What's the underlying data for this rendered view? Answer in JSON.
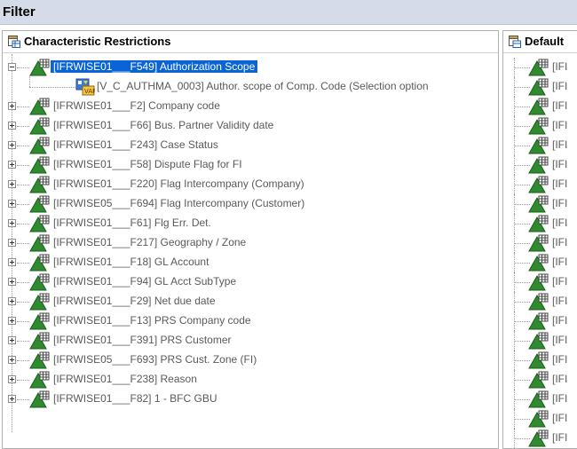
{
  "window": {
    "title": "Filter"
  },
  "left_panel": {
    "header": "Characteristic Restrictions",
    "selected_item": "[IFRWISE01___F549] Authorization Scope",
    "sub_item": "[V_C_AUTHMA_0003] Author. scope of Comp. Code (Selection option",
    "items": [
      "[IFRWISE01___F2] Company code",
      "[IFRWISE01___F66] Bus. Partner Validity date",
      "[IFRWISE01___F243] Case Status",
      "[IFRWISE01___F58] Dispute Flag for FI",
      "[IFRWISE01___F220] Flag Intercompany (Company)",
      "[IFRWISE05___F694] Flag Intercompany (Customer)",
      "[IFRWISE01___F61] Flg Err. Det.",
      "[IFRWISE01___F217] Geography / Zone",
      "[IFRWISE01___F18] GL Account",
      "[IFRWISE01___F94] GL Acct SubType",
      "[IFRWISE01___F29] Net due date",
      "[IFRWISE01___F13] PRS Company code",
      "[IFRWISE01___F391] PRS Customer",
      "[IFRWISE05___F693] PRS Cust. Zone (FI)",
      "[IFRWISE01___F238] Reason",
      "[IFRWISE01___F82] 1 - BFC GBU"
    ]
  },
  "right_panel": {
    "header": "Default",
    "item_prefix": "[IFI"
  },
  "icons": {
    "expand": "plus-box-icon",
    "collapse": "minus-box-icon",
    "characteristic": "green-triangle-grid-icon",
    "variable": "variable-icon",
    "panel_header": "table-icon"
  },
  "colors": {
    "selection": "#0a64d6",
    "triangle": "#2e8b2e",
    "titlebar": "#d6dbe9"
  }
}
